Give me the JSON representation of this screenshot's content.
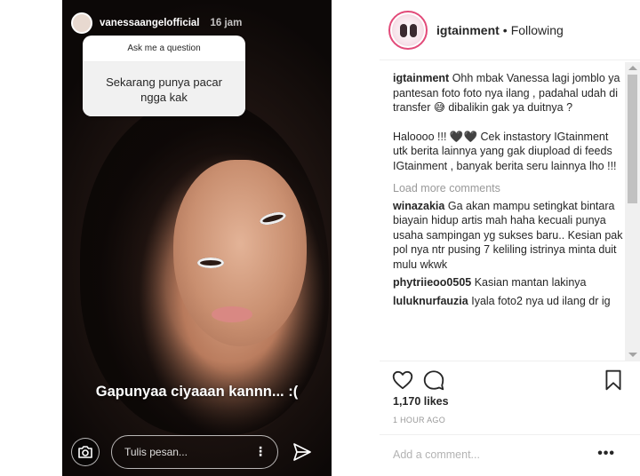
{
  "story": {
    "username": "vanessaangelofficial",
    "time": "16 jam",
    "question_title": "Ask me a question",
    "question_text": "Sekarang punya pacar ngga kak",
    "caption": "Gapunyaa ciyaaan kannn... :(",
    "message_placeholder": "Tulis pesan...",
    "more_label": "⋮"
  },
  "post": {
    "username": "igtainment",
    "dot": "•",
    "follow_status": "Following",
    "caption_user": "igtainment",
    "caption_text": "Ohh mbak Vanessa lagi jomblo ya pantesan foto foto nya ilang , padahal udah di transfer 😅 dibalikin gak ya duitnya ?",
    "caption_text2": "Haloooo !!! 🖤🖤 Cek instastory IGtainment utk berita lainnya yang gak diupload di feeds IGtainment , banyak berita seru lainnya lho !!!",
    "load_more": "Load more comments",
    "comments": [
      {
        "user": "winazakia",
        "text": "Ga akan mampu setingkat bintara biayain hidup artis mah haha kecuali punya usaha sampingan yg sukses baru.. Kesian pak pol nya ntr pusing 7 keliling istrinya minta duit mulu wkwk"
      },
      {
        "user": "phytriieoo0505",
        "text": "Kasian mantan lakinya"
      },
      {
        "user": "luluknurfauzia",
        "text": "Iyala foto2 nya ud ilang dr ig"
      }
    ],
    "likes": "1,170 likes",
    "time_ago": "1 HOUR AGO",
    "add_comment_placeholder": "Add a comment...",
    "more_label": "•••"
  },
  "icons": {
    "camera": "camera-icon",
    "send": "send-icon",
    "heart": "heart-icon",
    "comment": "comment-icon",
    "bookmark": "bookmark-icon"
  },
  "colors": {
    "story_ring": "#e24a79",
    "muted_text": "#999999"
  }
}
